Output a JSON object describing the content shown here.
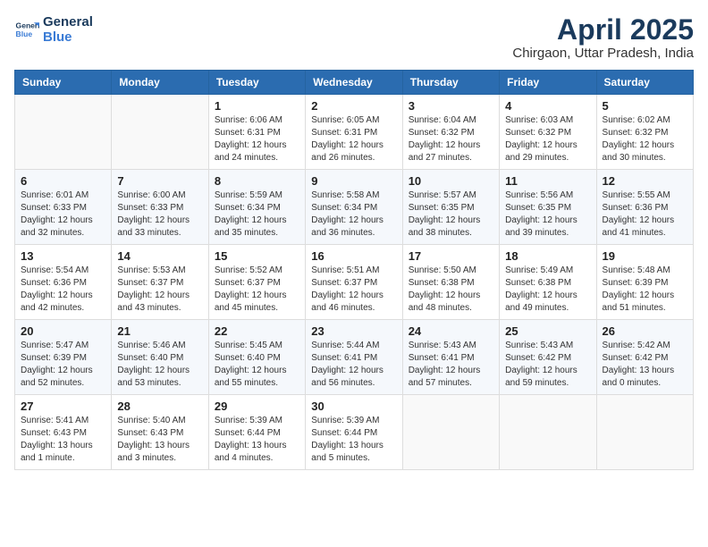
{
  "header": {
    "logo_line1": "General",
    "logo_line2": "Blue",
    "month": "April 2025",
    "location": "Chirgaon, Uttar Pradesh, India"
  },
  "weekdays": [
    "Sunday",
    "Monday",
    "Tuesday",
    "Wednesday",
    "Thursday",
    "Friday",
    "Saturday"
  ],
  "weeks": [
    [
      {
        "day": "",
        "info": ""
      },
      {
        "day": "",
        "info": ""
      },
      {
        "day": "1",
        "info": "Sunrise: 6:06 AM\nSunset: 6:31 PM\nDaylight: 12 hours and 24 minutes."
      },
      {
        "day": "2",
        "info": "Sunrise: 6:05 AM\nSunset: 6:31 PM\nDaylight: 12 hours and 26 minutes."
      },
      {
        "day": "3",
        "info": "Sunrise: 6:04 AM\nSunset: 6:32 PM\nDaylight: 12 hours and 27 minutes."
      },
      {
        "day": "4",
        "info": "Sunrise: 6:03 AM\nSunset: 6:32 PM\nDaylight: 12 hours and 29 minutes."
      },
      {
        "day": "5",
        "info": "Sunrise: 6:02 AM\nSunset: 6:32 PM\nDaylight: 12 hours and 30 minutes."
      }
    ],
    [
      {
        "day": "6",
        "info": "Sunrise: 6:01 AM\nSunset: 6:33 PM\nDaylight: 12 hours and 32 minutes."
      },
      {
        "day": "7",
        "info": "Sunrise: 6:00 AM\nSunset: 6:33 PM\nDaylight: 12 hours and 33 minutes."
      },
      {
        "day": "8",
        "info": "Sunrise: 5:59 AM\nSunset: 6:34 PM\nDaylight: 12 hours and 35 minutes."
      },
      {
        "day": "9",
        "info": "Sunrise: 5:58 AM\nSunset: 6:34 PM\nDaylight: 12 hours and 36 minutes."
      },
      {
        "day": "10",
        "info": "Sunrise: 5:57 AM\nSunset: 6:35 PM\nDaylight: 12 hours and 38 minutes."
      },
      {
        "day": "11",
        "info": "Sunrise: 5:56 AM\nSunset: 6:35 PM\nDaylight: 12 hours and 39 minutes."
      },
      {
        "day": "12",
        "info": "Sunrise: 5:55 AM\nSunset: 6:36 PM\nDaylight: 12 hours and 41 minutes."
      }
    ],
    [
      {
        "day": "13",
        "info": "Sunrise: 5:54 AM\nSunset: 6:36 PM\nDaylight: 12 hours and 42 minutes."
      },
      {
        "day": "14",
        "info": "Sunrise: 5:53 AM\nSunset: 6:37 PM\nDaylight: 12 hours and 43 minutes."
      },
      {
        "day": "15",
        "info": "Sunrise: 5:52 AM\nSunset: 6:37 PM\nDaylight: 12 hours and 45 minutes."
      },
      {
        "day": "16",
        "info": "Sunrise: 5:51 AM\nSunset: 6:37 PM\nDaylight: 12 hours and 46 minutes."
      },
      {
        "day": "17",
        "info": "Sunrise: 5:50 AM\nSunset: 6:38 PM\nDaylight: 12 hours and 48 minutes."
      },
      {
        "day": "18",
        "info": "Sunrise: 5:49 AM\nSunset: 6:38 PM\nDaylight: 12 hours and 49 minutes."
      },
      {
        "day": "19",
        "info": "Sunrise: 5:48 AM\nSunset: 6:39 PM\nDaylight: 12 hours and 51 minutes."
      }
    ],
    [
      {
        "day": "20",
        "info": "Sunrise: 5:47 AM\nSunset: 6:39 PM\nDaylight: 12 hours and 52 minutes."
      },
      {
        "day": "21",
        "info": "Sunrise: 5:46 AM\nSunset: 6:40 PM\nDaylight: 12 hours and 53 minutes."
      },
      {
        "day": "22",
        "info": "Sunrise: 5:45 AM\nSunset: 6:40 PM\nDaylight: 12 hours and 55 minutes."
      },
      {
        "day": "23",
        "info": "Sunrise: 5:44 AM\nSunset: 6:41 PM\nDaylight: 12 hours and 56 minutes."
      },
      {
        "day": "24",
        "info": "Sunrise: 5:43 AM\nSunset: 6:41 PM\nDaylight: 12 hours and 57 minutes."
      },
      {
        "day": "25",
        "info": "Sunrise: 5:43 AM\nSunset: 6:42 PM\nDaylight: 12 hours and 59 minutes."
      },
      {
        "day": "26",
        "info": "Sunrise: 5:42 AM\nSunset: 6:42 PM\nDaylight: 13 hours and 0 minutes."
      }
    ],
    [
      {
        "day": "27",
        "info": "Sunrise: 5:41 AM\nSunset: 6:43 PM\nDaylight: 13 hours and 1 minute."
      },
      {
        "day": "28",
        "info": "Sunrise: 5:40 AM\nSunset: 6:43 PM\nDaylight: 13 hours and 3 minutes."
      },
      {
        "day": "29",
        "info": "Sunrise: 5:39 AM\nSunset: 6:44 PM\nDaylight: 13 hours and 4 minutes."
      },
      {
        "day": "30",
        "info": "Sunrise: 5:39 AM\nSunset: 6:44 PM\nDaylight: 13 hours and 5 minutes."
      },
      {
        "day": "",
        "info": ""
      },
      {
        "day": "",
        "info": ""
      },
      {
        "day": "",
        "info": ""
      }
    ]
  ]
}
